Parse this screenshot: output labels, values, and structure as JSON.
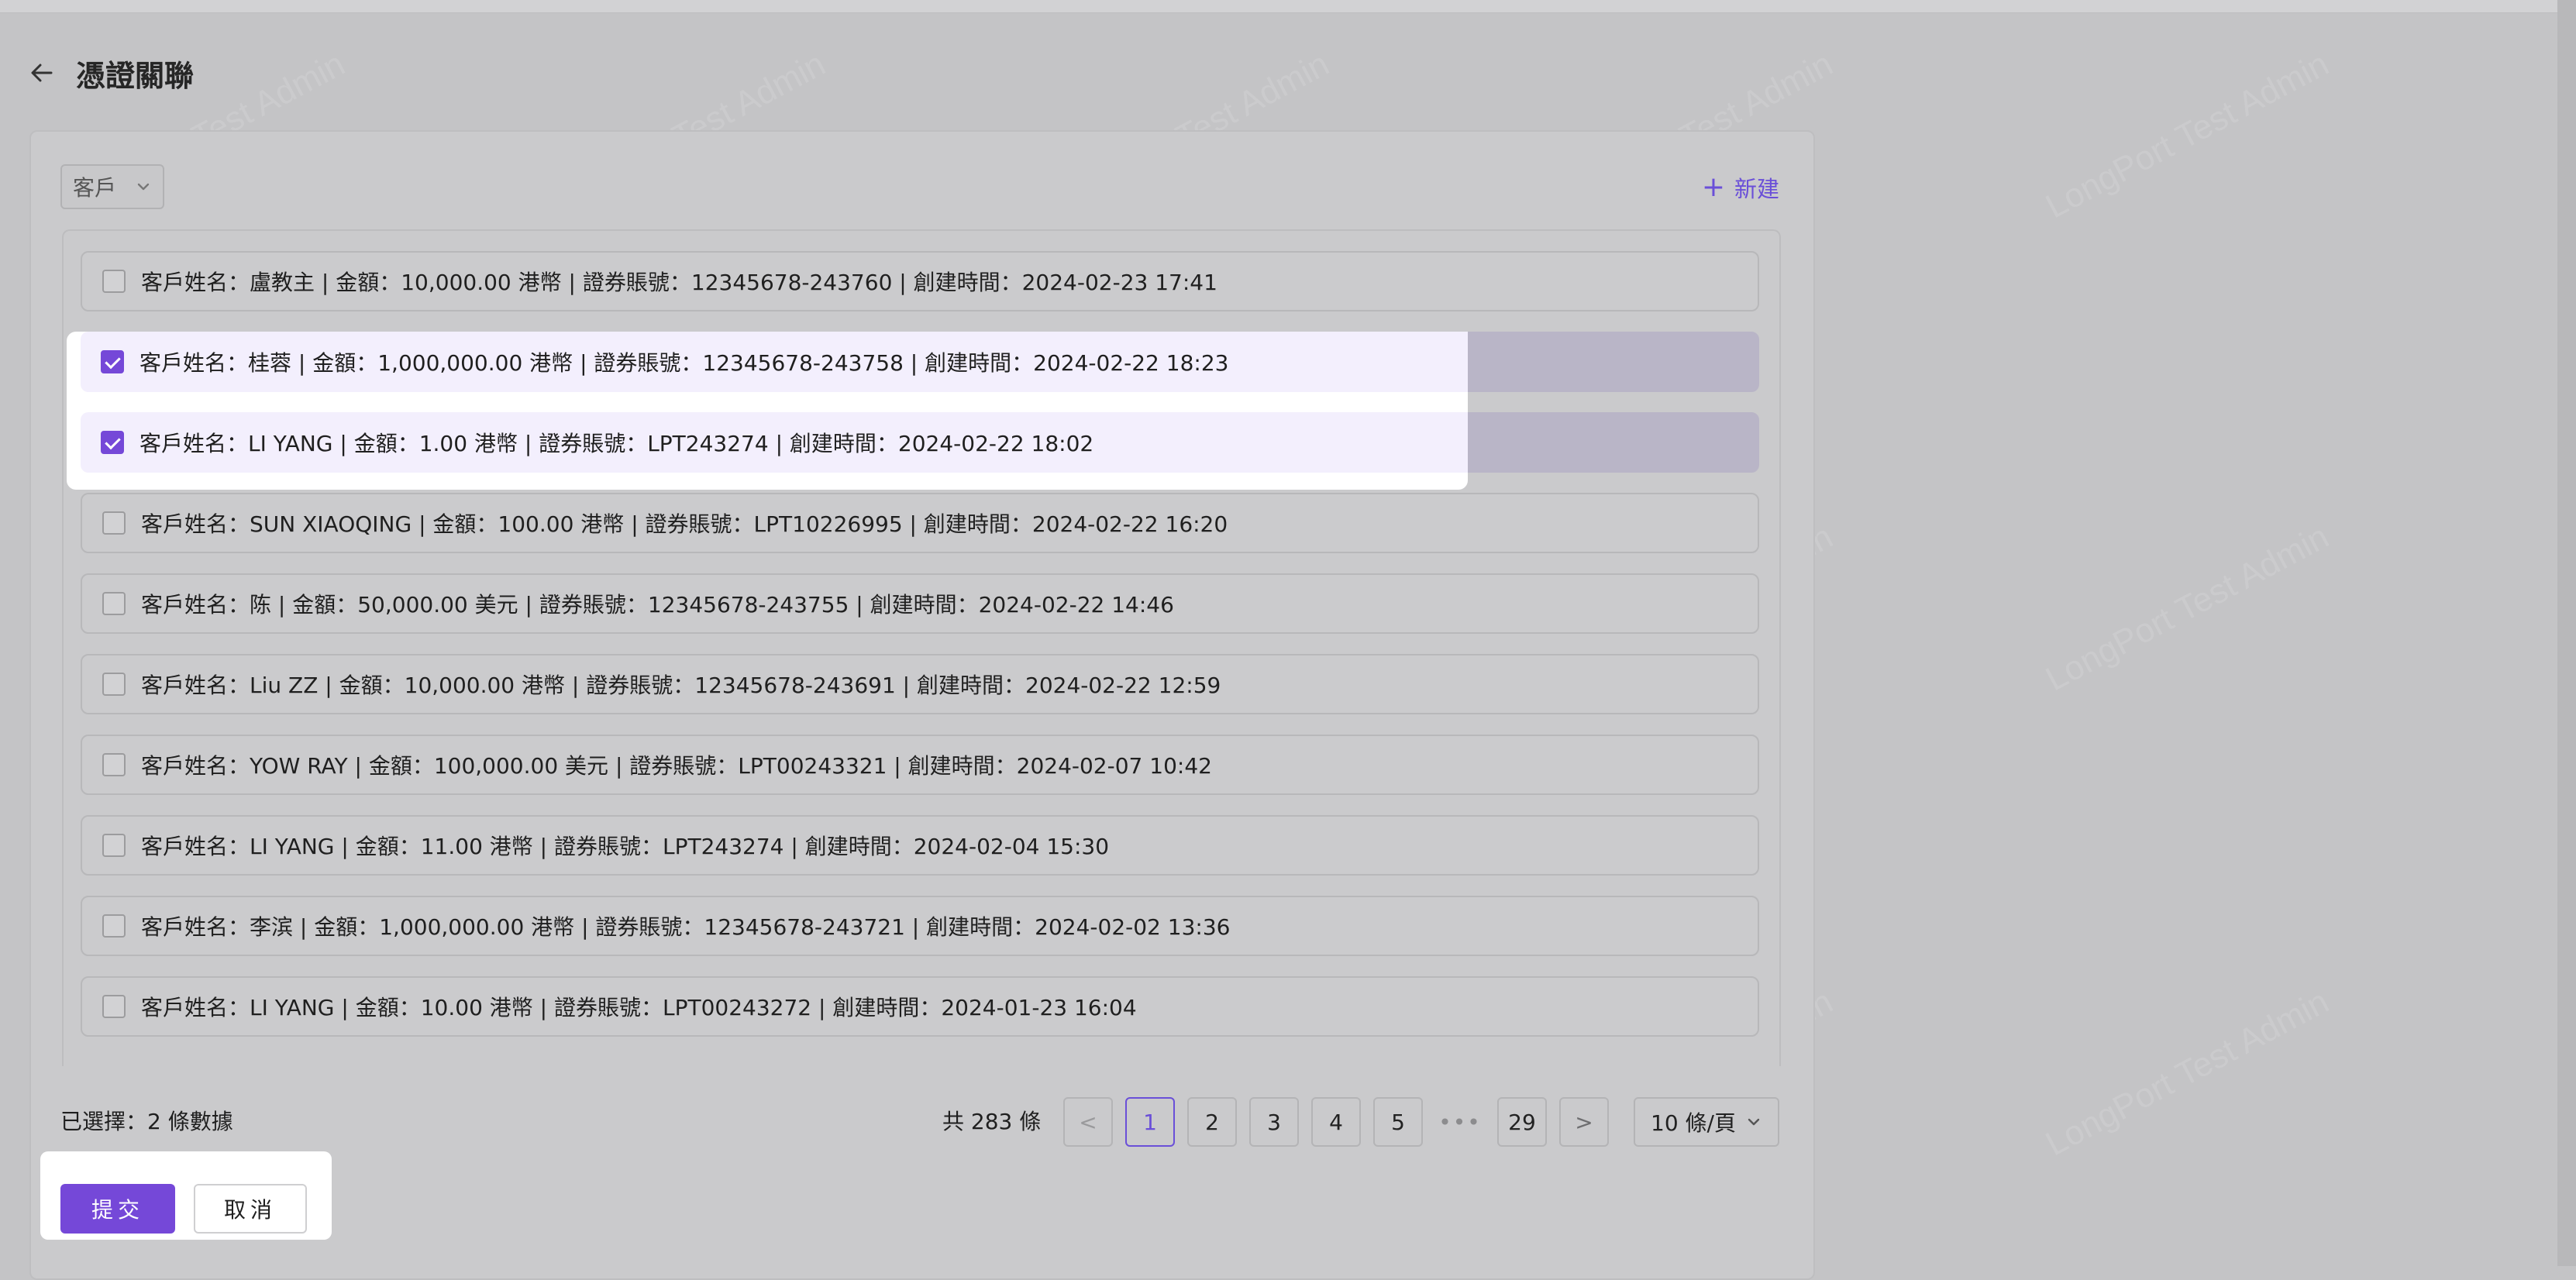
{
  "header": {
    "title": "憑證關聯"
  },
  "filter": {
    "select_value": "客戶"
  },
  "toolbar": {
    "new_label": "新建"
  },
  "records": [
    {
      "text": "客戶姓名：盧教主 | 金額：10,000.00 港幣 | 證券賬號：12345678-243760 | 創建時間：2024-02-23 17:41",
      "checked": false
    },
    {
      "text": "客戶姓名：桂蓉 | 金額：1,000,000.00 港幣 | 證券賬號：12345678-243758 | 創建時間：2024-02-22 18:23",
      "checked": true
    },
    {
      "text": "客戶姓名：LI YANG | 金額：1.00 港幣 | 證券賬號：LPT243274 | 創建時間：2024-02-22 18:02",
      "checked": true
    },
    {
      "text": "客戶姓名：SUN XIAOQING | 金額：100.00 港幣 | 證券賬號：LPT10226995 | 創建時間：2024-02-22 16:20",
      "checked": false
    },
    {
      "text": "客戶姓名：陈 | 金額：50,000.00 美元 | 證券賬號：12345678-243755 | 創建時間：2024-02-22 14:46",
      "checked": false
    },
    {
      "text": "客戶姓名：Liu ZZ | 金額：10,000.00 港幣 | 證券賬號：12345678-243691 | 創建時間：2024-02-22 12:59",
      "checked": false
    },
    {
      "text": "客戶姓名：YOW RAY | 金額：100,000.00 美元 | 證券賬號：LPT00243321 | 創建時間：2024-02-07 10:42",
      "checked": false
    },
    {
      "text": "客戶姓名：LI YANG | 金額：11.00 港幣 | 證券賬號：LPT243274 | 創建時間：2024-02-04 15:30",
      "checked": false
    },
    {
      "text": "客戶姓名：李滨 | 金額：1,000,000.00 港幣 | 證券賬號：12345678-243721 | 創建時間：2024-02-02 13:36",
      "checked": false
    },
    {
      "text": "客戶姓名：LI YANG | 金額：10.00 港幣 | 證券賬號：LPT00243272 | 創建時間：2024-01-23 16:04",
      "checked": false
    }
  ],
  "footer": {
    "selected_label": "已選擇：2 條數據",
    "total_label": "共 283 條",
    "pages": [
      "1",
      "2",
      "3",
      "4",
      "5"
    ],
    "last_page": "29",
    "ellipsis": "•••",
    "prev_symbol": "<",
    "next_symbol": ">",
    "page_size": "10 條/頁",
    "current_page": "1"
  },
  "actions": {
    "submit_label": "提交",
    "cancel_label": "取消"
  },
  "watermark_text": "LongPort Test Admin",
  "colors": {
    "accent": "#7548d8",
    "link": "#6a4fd8",
    "overlay_bg": "#c4c4c6"
  }
}
